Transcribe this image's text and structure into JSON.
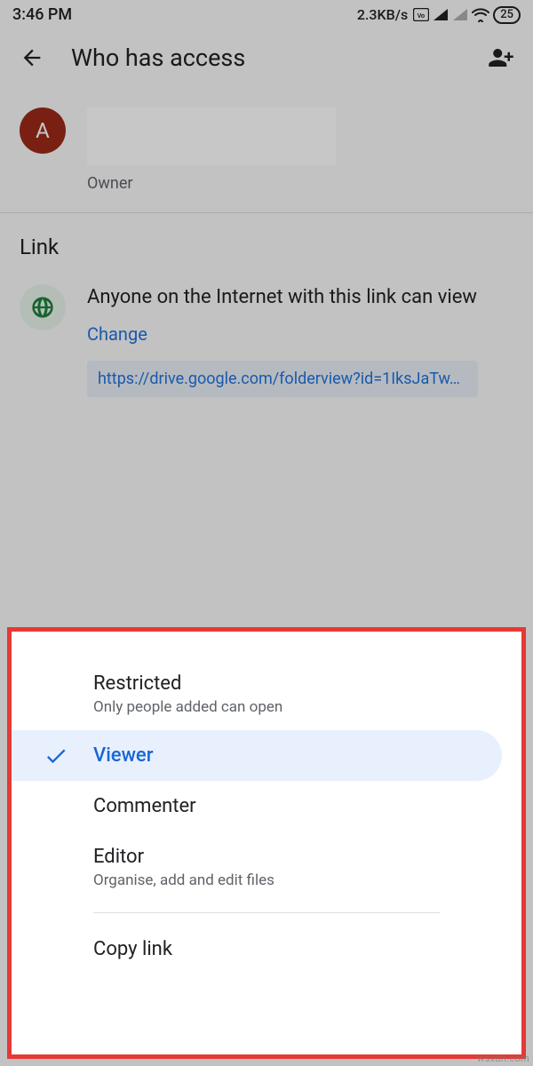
{
  "status_bar": {
    "time": "3:46 PM",
    "network_speed": "2.3KB/s",
    "battery": "25"
  },
  "header": {
    "title": "Who has access"
  },
  "person": {
    "avatar_letter": "A",
    "role": "Owner"
  },
  "link_section": {
    "heading": "Link",
    "description": "Anyone on the Internet with this link can view",
    "change_label": "Change",
    "url": "https://drive.google.com/folderview?id=1IksJaTw…"
  },
  "sheet": {
    "options": [
      {
        "title": "Restricted",
        "subtitle": "Only people added can open",
        "selected": false
      },
      {
        "title": "Viewer",
        "subtitle": "",
        "selected": true
      },
      {
        "title": "Commenter",
        "subtitle": "",
        "selected": false
      },
      {
        "title": "Editor",
        "subtitle": "Organise, add and edit files",
        "selected": false
      }
    ],
    "copy_label": "Copy link"
  },
  "watermark": "wsxdn.com"
}
